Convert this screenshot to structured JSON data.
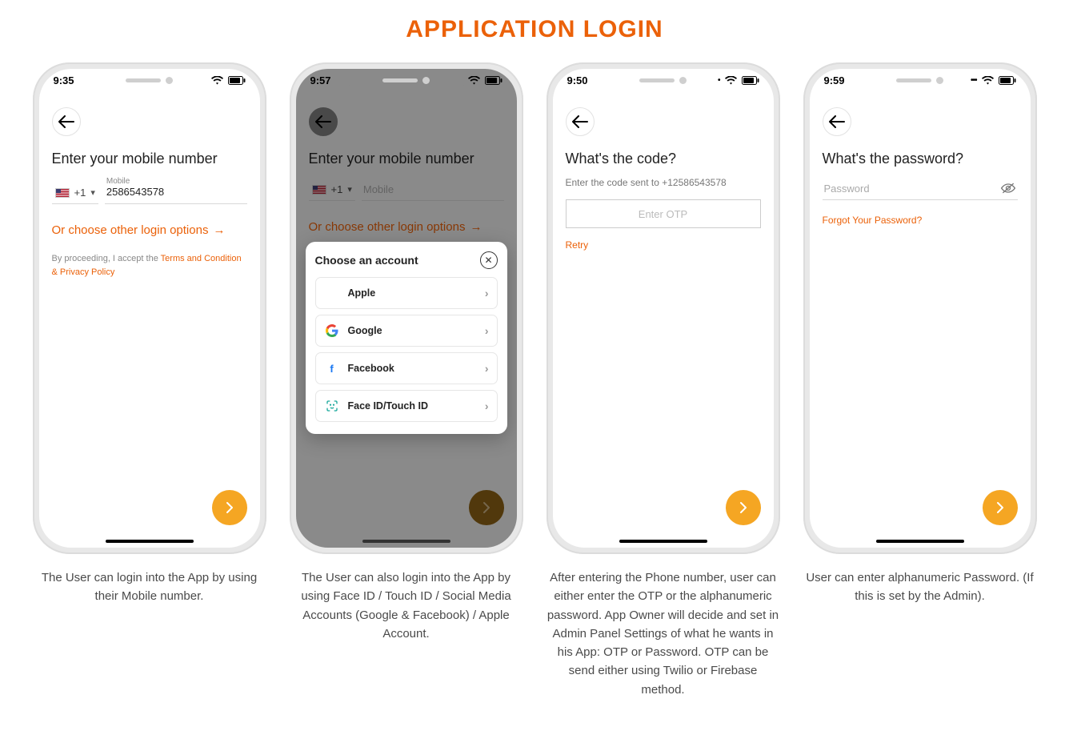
{
  "page_title": "APPLICATION LOGIN",
  "accent_color": "#eb6109",
  "fab_color": "#f5a623",
  "screens": [
    {
      "status_time": "9:35",
      "title": "Enter your mobile number",
      "country_code": "+1",
      "mobile_label": "Mobile",
      "mobile_value": "2586543578",
      "other_login": "Or choose other login options",
      "proceed_prefix": "By proceeding, I accept the ",
      "terms_link": "Terms and Condition & Privacy Policy",
      "caption": "The User can login into the App by using their Mobile number."
    },
    {
      "status_time": "9:57",
      "title": "Enter your mobile number",
      "country_code": "+1",
      "mobile_label": "Mobile",
      "mobile_value": "",
      "other_login": "Or choose other login options",
      "sheet_title": "Choose an account",
      "options": [
        {
          "label": "Apple",
          "icon": "apple"
        },
        {
          "label": "Google",
          "icon": "google"
        },
        {
          "label": "Facebook",
          "icon": "facebook"
        },
        {
          "label": "Face ID/Touch ID",
          "icon": "faceid"
        }
      ],
      "caption": "The User can also login into the App by using Face ID / Touch ID / Social Media Accounts (Google & Facebook) / Apple Account."
    },
    {
      "status_time": "9:50",
      "title": "What's the code?",
      "subtitle": "Enter the code  sent to +12586543578",
      "otp_placeholder": "Enter OTP",
      "retry": "Retry",
      "caption": "After entering the Phone number, user can either enter the OTP or the alphanumeric password. App Owner will decide and set in Admin Panel Settings of what he wants in his App: OTP or Password. OTP can be send either using Twilio or Firebase method."
    },
    {
      "status_time": "9:59",
      "title": "What's the password?",
      "password_placeholder": "Password",
      "forgot": "Forgot Your Password?",
      "caption": "User can enter alphanumeric Password. (If this is set by the Admin)."
    }
  ]
}
